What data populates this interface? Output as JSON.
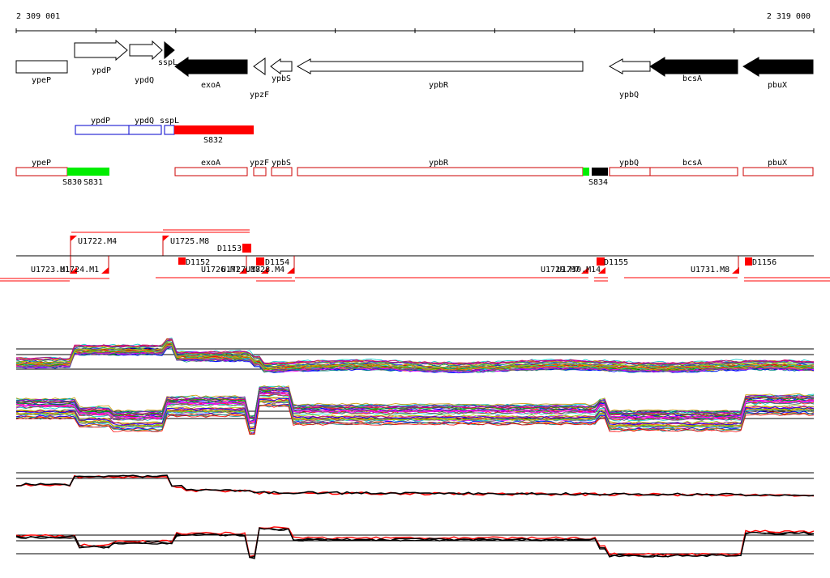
{
  "coords": {
    "start": "2 309 001",
    "end": "2 319 000"
  },
  "colors": {
    "forward": "#ffffff",
    "reverse_black": "#000000",
    "blue_box": "#0000cc",
    "red_box": "#cc0000",
    "red_fill": "#ff0000",
    "green_fill": "#00ee00"
  },
  "genes": [
    {
      "label": "ypeP",
      "strand": "none",
      "fill": "white"
    },
    {
      "label": "ypdP",
      "strand": "+",
      "fill": "white"
    },
    {
      "label": "ypdQ",
      "strand": "+",
      "fill": "white"
    },
    {
      "label": "sspL",
      "strand": "+",
      "fill": "black"
    },
    {
      "label": "exoA",
      "strand": "-",
      "fill": "black"
    },
    {
      "label": "ypzF",
      "strand": "-",
      "fill": "white"
    },
    {
      "label": "ypbS",
      "strand": "-",
      "fill": "white"
    },
    {
      "label": "ypbR",
      "strand": "-",
      "fill": "white"
    },
    {
      "label": "ypbQ",
      "strand": "-",
      "fill": "white"
    },
    {
      "label": "bcsA",
      "strand": "-",
      "fill": "black"
    },
    {
      "label": "pbuX",
      "strand": "-",
      "fill": "black"
    }
  ],
  "upper_track": {
    "boxes": [
      "ypdP",
      "ypdQ",
      "sspL"
    ],
    "segment": "S832"
  },
  "lower_track": {
    "boxes": [
      "ypeP",
      "exoA",
      "ypzF",
      "ypbS",
      "ypbR",
      "ypbQ",
      "bcsA",
      "pbuX"
    ],
    "segments": [
      "S830",
      "S831",
      "S834"
    ]
  },
  "features_above": [
    "U1722.M4",
    "U1725.M8",
    "D1153"
  ],
  "features_below": [
    "U1723.M1",
    "U1724.M1",
    "D1152",
    "U1726.M1",
    "U1727.M8",
    "U1728.M4",
    "D1154",
    "U1729.M7",
    "U1730.M14",
    "D1155",
    "U1731.M8",
    "D1156"
  ]
}
